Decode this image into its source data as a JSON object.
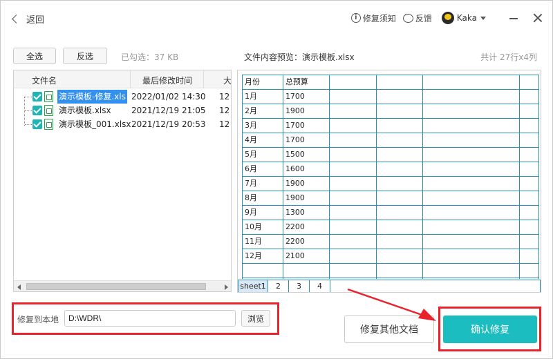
{
  "header": {
    "back_label": "返回",
    "repair_notes": "修复须知",
    "feedback": "反馈",
    "user_name": "Kaka"
  },
  "toolbar": {
    "select_all": "全选",
    "invert_select": "反选",
    "selected_info": "已勾选：37 KB"
  },
  "file_list": {
    "columns": [
      "文件名",
      "最后修改时间",
      "大"
    ],
    "rows": [
      {
        "name": "演示模板-修复.xls",
        "time": "2022/01/02 14:30",
        "size": "12",
        "selected": true
      },
      {
        "name": "演示模板.xlsx",
        "time": "2021/12/19 21:05",
        "size": "12",
        "selected": false
      },
      {
        "name": "演示模板_001.xlsx",
        "time": "2021/12/19 20:53",
        "size": "12",
        "selected": false
      }
    ]
  },
  "preview": {
    "title": "文件内容预览：演示模板.xlsx",
    "count": "共计 27行x4列",
    "table": [
      [
        "月份",
        "总预算",
        "",
        "",
        "",
        ""
      ],
      [
        "1月",
        "1700",
        "",
        "",
        "",
        ""
      ],
      [
        "2月",
        "1900",
        "",
        "",
        "",
        ""
      ],
      [
        "3月",
        "1700",
        "",
        "",
        "",
        ""
      ],
      [
        "4月",
        "1700",
        "",
        "",
        "",
        ""
      ],
      [
        "5月",
        "1500",
        "",
        "",
        "",
        ""
      ],
      [
        "6月",
        "1600",
        "",
        "",
        "",
        ""
      ],
      [
        "7月",
        "1900",
        "",
        "",
        "",
        ""
      ],
      [
        "8月",
        "1900",
        "",
        "",
        "",
        ""
      ],
      [
        "9月",
        "1300",
        "",
        "",
        "",
        ""
      ],
      [
        "10月",
        "2200",
        "",
        "",
        "",
        ""
      ],
      [
        "11月",
        "2200",
        "",
        "",
        "",
        ""
      ],
      [
        "12月",
        "2100",
        "",
        "",
        "",
        ""
      ],
      [
        "",
        "",
        "",
        "",
        "",
        ""
      ],
      [
        "",
        "",
        "",
        "",
        "",
        ""
      ]
    ],
    "sheets": [
      "sheet1",
      "2",
      "3",
      "4"
    ]
  },
  "bottom": {
    "save_label": "修复到本地",
    "path": "D:\\WDR\\",
    "browse": "浏览",
    "repair_other": "修复其他文档",
    "confirm": "确认修复"
  },
  "colors": {
    "accent": "#1bbdc0",
    "checkbox": "#1fb5b5",
    "selection": "#3390ee",
    "grid_line": "#2a8fb6",
    "annotation": "#e8232b"
  }
}
